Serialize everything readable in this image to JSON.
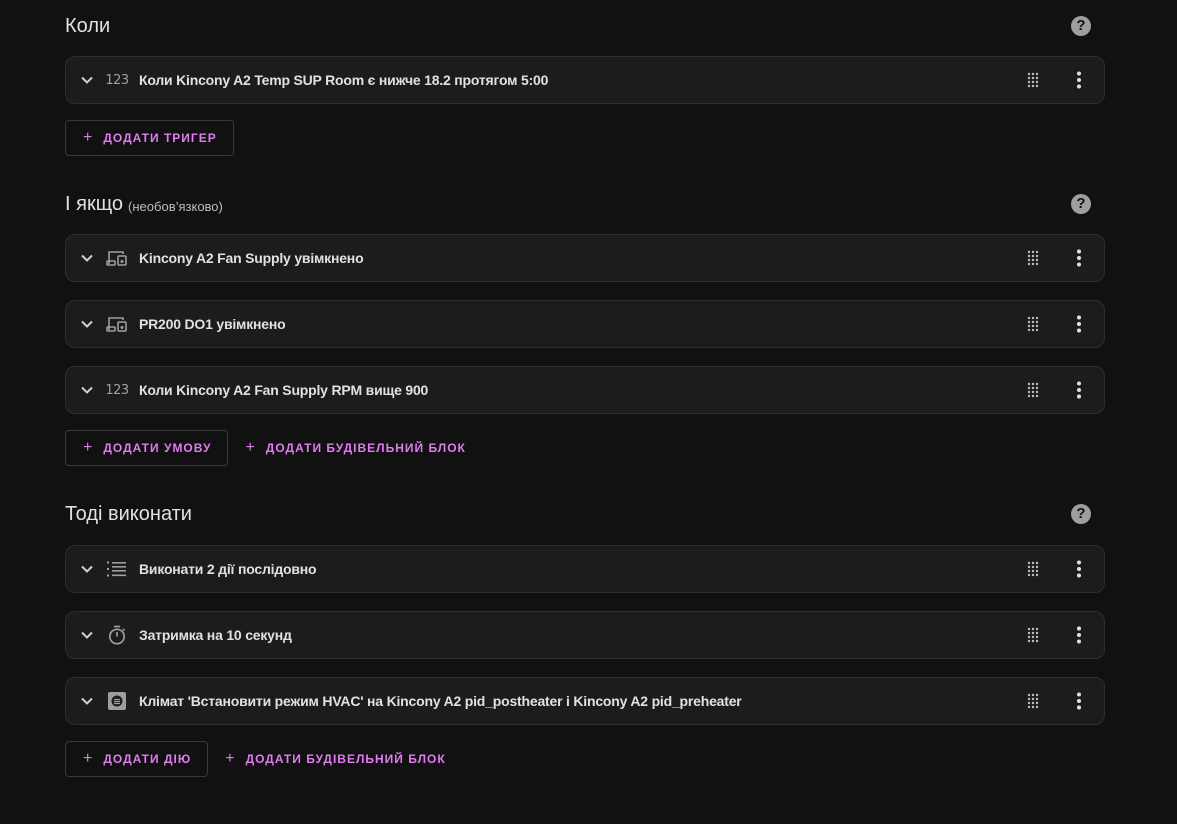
{
  "triggers": {
    "title": "Коли",
    "note": "",
    "items": [
      {
        "icon": "numeric-icon",
        "icon_text": "123",
        "label": "Коли Kincony A2 Temp SUP Room є нижче 18.2 протягом 5:00"
      }
    ],
    "add_button": "ДОДАТИ ТРИГЕР"
  },
  "conditions": {
    "title": "І якщо",
    "note": "(необов’язково)",
    "items": [
      {
        "icon": "device-icon",
        "label": "Kincony A2 Fan Supply увімкнено"
      },
      {
        "icon": "device-icon",
        "label": "PR200 DO1 увімкнено"
      },
      {
        "icon": "numeric-icon",
        "icon_text": "123",
        "label": "Коли Kincony A2 Fan Supply RPM вище 900"
      }
    ],
    "add_button": "ДОДАТИ УМОВУ",
    "add_block_button": "ДОДАТИ БУДІВЕЛЬНИЙ БЛОК"
  },
  "actions": {
    "title": "Тоді виконати",
    "note": "",
    "items": [
      {
        "icon": "sequence-icon",
        "label": "Виконати 2 дії послідовно"
      },
      {
        "icon": "timer-icon",
        "label": "Затримка на 10 секунд"
      },
      {
        "icon": "climate-icon",
        "label": "Клімат 'Встановити режим HVAC' на Kincony A2 pid_postheater і Kincony A2 pid_preheater"
      }
    ],
    "add_button": "ДОДАТИ ДІЮ",
    "add_block_button": "ДОДАТИ БУДІВЕЛЬНИЙ БЛОК"
  },
  "help_symbol": "?",
  "plus_symbol": "+",
  "colors": {
    "background": "#111111",
    "card": "#1c1c1c",
    "accent": "#e07cf0",
    "icon": "#9e9e9e"
  }
}
